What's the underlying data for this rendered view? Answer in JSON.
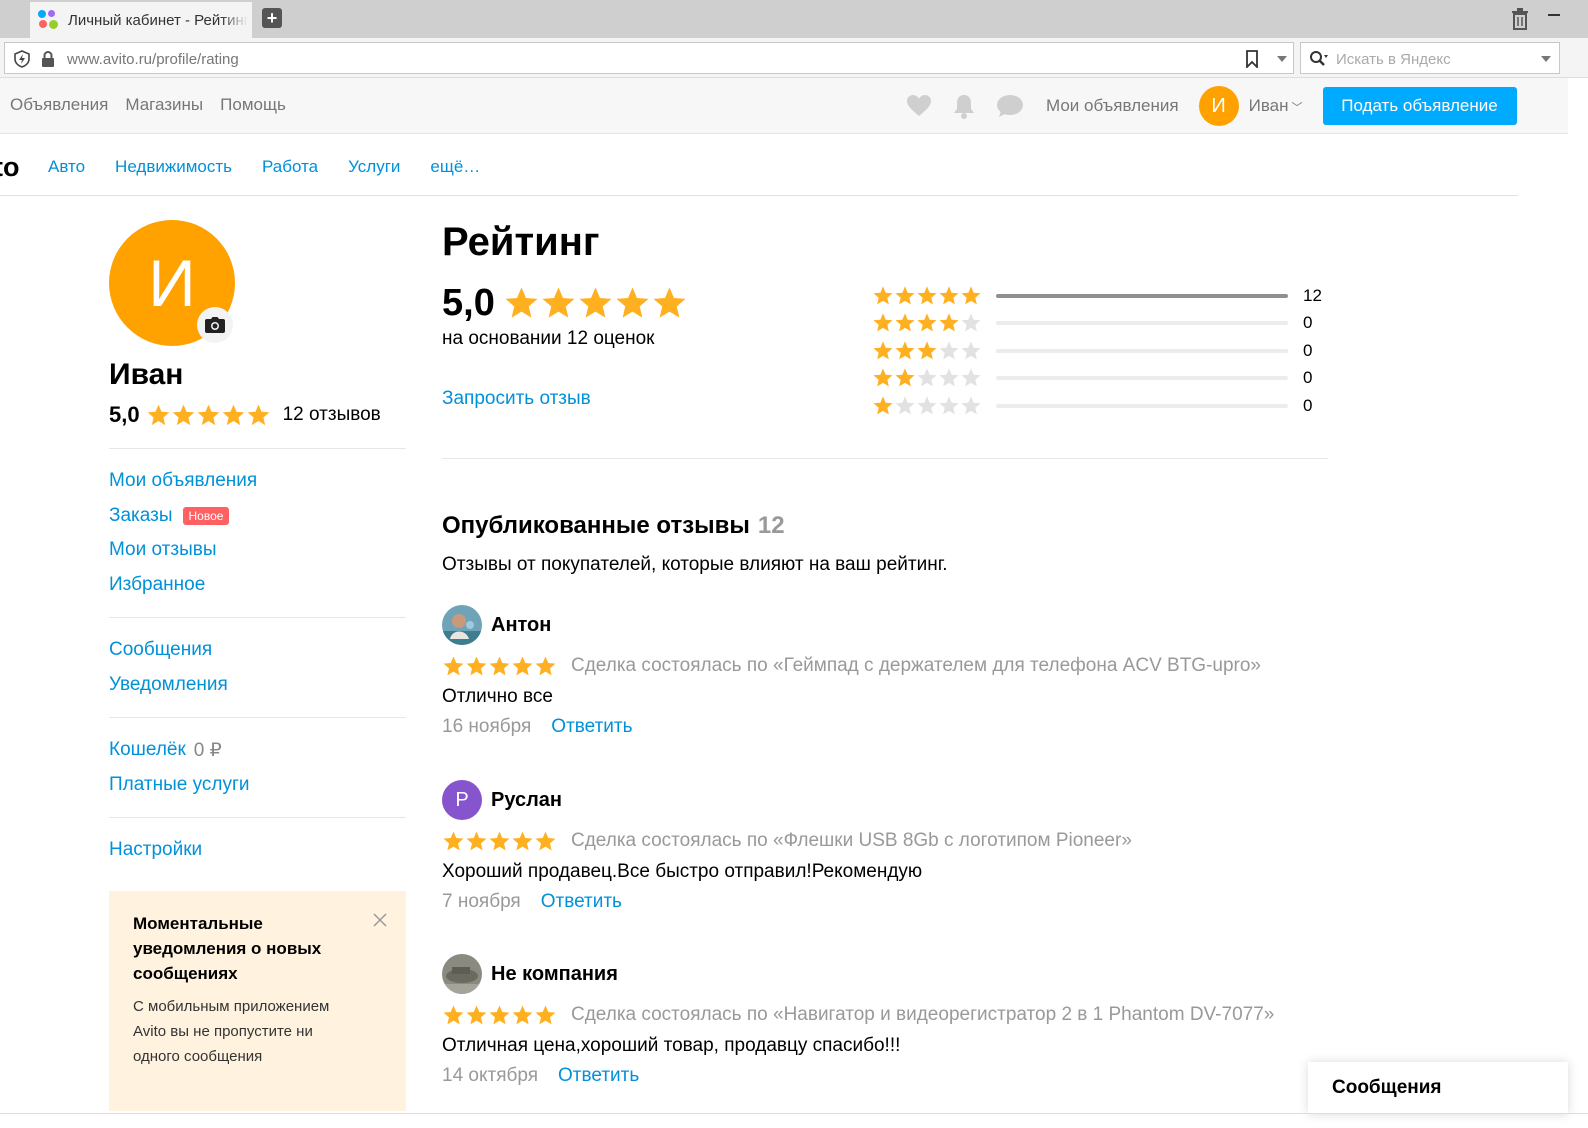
{
  "browser": {
    "tab_title": "Личный кабинет - Рейтинг",
    "url": "www.avito.ru/profile/rating",
    "search_placeholder": "Искать в Яндекс"
  },
  "header": {
    "nav": [
      "Объявления",
      "Магазины",
      "Помощь"
    ],
    "my_ads": "Мои объявления",
    "avatar_letter": "И",
    "user_name": "Иван",
    "post_button": "Подать объявление",
    "accent": "#00aaff",
    "avatar_color": "#ffa200"
  },
  "categories": {
    "logo_fragment": "to",
    "items": [
      "Авто",
      "Недвижимость",
      "Работа",
      "Услуги",
      "ещё…"
    ]
  },
  "sidebar": {
    "avatar_letter": "И",
    "name": "Иван",
    "rating": "5,0",
    "rating_stars": 5,
    "reviews": "12 отзывов",
    "group1": [
      "Мои объявления",
      "Заказы",
      "Мои отзывы",
      "Избранное"
    ],
    "orders_badge": "Новое",
    "group2": [
      "Сообщения",
      "Уведомления"
    ],
    "wallet_label": "Кошелёк",
    "wallet_value": "0 ₽",
    "paid_services": "Платные услуги",
    "settings": "Настройки"
  },
  "promo": {
    "title": "Моментальные уведомления о новых сообщениях",
    "text": "С мобильным приложением Avito вы не пропустите ни одного сообщения"
  },
  "rating": {
    "title": "Рейтинг",
    "score": "5,0",
    "stars": 5,
    "based_on": "на основании 12 оценок",
    "request_review": "Запросить отзыв",
    "distribution": [
      {
        "stars": 5,
        "count": 12,
        "fraction": 1.0
      },
      {
        "stars": 4,
        "count": 0,
        "fraction": 0
      },
      {
        "stars": 3,
        "count": 0,
        "fraction": 0
      },
      {
        "stars": 2,
        "count": 0,
        "fraction": 0
      },
      {
        "stars": 1,
        "count": 0,
        "fraction": 0
      }
    ],
    "star_color": "#ffb021",
    "star_empty_color": "#e2e2e2"
  },
  "reviews": {
    "title": "Опубликованные отзывы",
    "count": "12",
    "subtitle": "Отзывы от покупателей, которые влияют на ваш рейтинг.",
    "reply_label": "Ответить",
    "items": [
      {
        "name": "Антон",
        "avatar": "photo",
        "stars": 5,
        "deal": "Сделка состоялась по «Геймпад с держателем для телефона ACV BTG-upro»",
        "text": "Отлично все",
        "date": "16 ноября"
      },
      {
        "name": "Руслан",
        "avatar": "Р",
        "avatar_color": "#8654cc",
        "stars": 5,
        "deal": "Сделка состоялась по «Флешки USB 8Gb с логотипом Pioneer»",
        "text": "Хороший продавец.Все быстро отправил!Рекомендую",
        "date": "7 ноября"
      },
      {
        "name": "Не компания",
        "avatar": "photo",
        "stars": 5,
        "deal": "Сделка состоялась по «Навигатор и видеорегистратор 2 в 1 Phantom DV-7077»",
        "text": "Отличная цена,хороший товар, продавцу спасибо!!!",
        "date": "14 октября"
      }
    ]
  },
  "messages_widget": "Сообщения"
}
